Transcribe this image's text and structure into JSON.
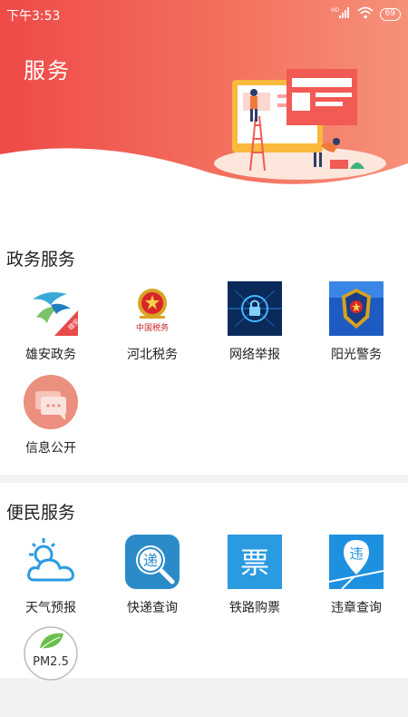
{
  "status_bar": {
    "time": "下午3:53",
    "signal_label": "HD",
    "battery": "69"
  },
  "header": {
    "title": "服务"
  },
  "sections": [
    {
      "title": "政务服务",
      "items": [
        {
          "label": "雄安政务",
          "icon": "xiongan-logo-icon"
        },
        {
          "label": "河北税务",
          "icon": "tax-emblem-icon"
        },
        {
          "label": "网络举报",
          "icon": "network-report-icon"
        },
        {
          "label": "阳光警务",
          "icon": "police-badge-icon"
        },
        {
          "label": "信息公开",
          "icon": "chat-bubble-icon"
        }
      ]
    },
    {
      "title": "便民服务",
      "items": [
        {
          "label": "天气预报",
          "icon": "weather-icon"
        },
        {
          "label": "快递查询",
          "icon": "express-search-icon"
        },
        {
          "label": "铁路购票",
          "icon": "train-ticket-icon"
        },
        {
          "label": "违章查询",
          "icon": "violation-icon"
        },
        {
          "label": "",
          "icon": "pm25-icon",
          "text": "PM2.5"
        }
      ]
    }
  ],
  "icon_text": {
    "tax_seal": "中国税务",
    "xiongan_badge": "雄安",
    "express_char": "递",
    "ticket_char": "票",
    "violation_char": "违"
  },
  "colors": {
    "header_start": "#ee4a48",
    "header_end": "#f69179",
    "accent_blue": "#2a9be0",
    "divider": "#f2f2f2"
  }
}
